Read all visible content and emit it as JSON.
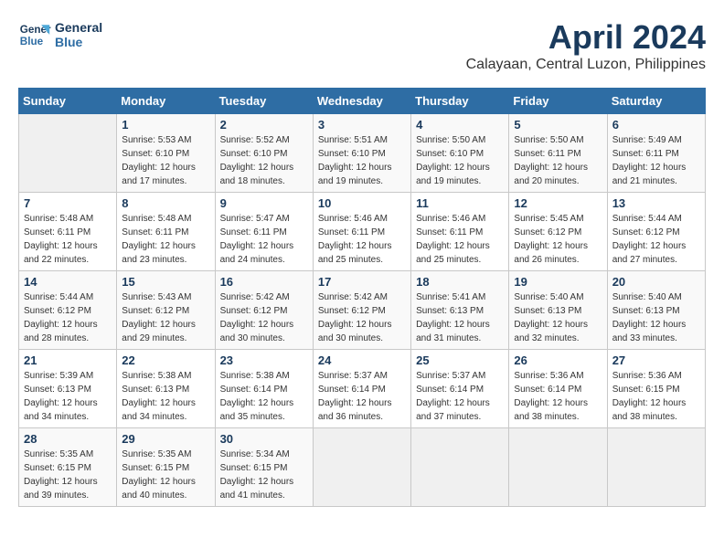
{
  "header": {
    "logo_line1": "General",
    "logo_line2": "Blue",
    "month": "April 2024",
    "location": "Calayaan, Central Luzon, Philippines"
  },
  "weekdays": [
    "Sunday",
    "Monday",
    "Tuesday",
    "Wednesday",
    "Thursday",
    "Friday",
    "Saturday"
  ],
  "weeks": [
    [
      {
        "day": "",
        "sunrise": "",
        "sunset": "",
        "daylight": ""
      },
      {
        "day": "1",
        "sunrise": "Sunrise: 5:53 AM",
        "sunset": "Sunset: 6:10 PM",
        "daylight": "Daylight: 12 hours and 17 minutes."
      },
      {
        "day": "2",
        "sunrise": "Sunrise: 5:52 AM",
        "sunset": "Sunset: 6:10 PM",
        "daylight": "Daylight: 12 hours and 18 minutes."
      },
      {
        "day": "3",
        "sunrise": "Sunrise: 5:51 AM",
        "sunset": "Sunset: 6:10 PM",
        "daylight": "Daylight: 12 hours and 19 minutes."
      },
      {
        "day": "4",
        "sunrise": "Sunrise: 5:50 AM",
        "sunset": "Sunset: 6:10 PM",
        "daylight": "Daylight: 12 hours and 19 minutes."
      },
      {
        "day": "5",
        "sunrise": "Sunrise: 5:50 AM",
        "sunset": "Sunset: 6:11 PM",
        "daylight": "Daylight: 12 hours and 20 minutes."
      },
      {
        "day": "6",
        "sunrise": "Sunrise: 5:49 AM",
        "sunset": "Sunset: 6:11 PM",
        "daylight": "Daylight: 12 hours and 21 minutes."
      }
    ],
    [
      {
        "day": "7",
        "sunrise": "Sunrise: 5:48 AM",
        "sunset": "Sunset: 6:11 PM",
        "daylight": "Daylight: 12 hours and 22 minutes."
      },
      {
        "day": "8",
        "sunrise": "Sunrise: 5:48 AM",
        "sunset": "Sunset: 6:11 PM",
        "daylight": "Daylight: 12 hours and 23 minutes."
      },
      {
        "day": "9",
        "sunrise": "Sunrise: 5:47 AM",
        "sunset": "Sunset: 6:11 PM",
        "daylight": "Daylight: 12 hours and 24 minutes."
      },
      {
        "day": "10",
        "sunrise": "Sunrise: 5:46 AM",
        "sunset": "Sunset: 6:11 PM",
        "daylight": "Daylight: 12 hours and 25 minutes."
      },
      {
        "day": "11",
        "sunrise": "Sunrise: 5:46 AM",
        "sunset": "Sunset: 6:11 PM",
        "daylight": "Daylight: 12 hours and 25 minutes."
      },
      {
        "day": "12",
        "sunrise": "Sunrise: 5:45 AM",
        "sunset": "Sunset: 6:12 PM",
        "daylight": "Daylight: 12 hours and 26 minutes."
      },
      {
        "day": "13",
        "sunrise": "Sunrise: 5:44 AM",
        "sunset": "Sunset: 6:12 PM",
        "daylight": "Daylight: 12 hours and 27 minutes."
      }
    ],
    [
      {
        "day": "14",
        "sunrise": "Sunrise: 5:44 AM",
        "sunset": "Sunset: 6:12 PM",
        "daylight": "Daylight: 12 hours and 28 minutes."
      },
      {
        "day": "15",
        "sunrise": "Sunrise: 5:43 AM",
        "sunset": "Sunset: 6:12 PM",
        "daylight": "Daylight: 12 hours and 29 minutes."
      },
      {
        "day": "16",
        "sunrise": "Sunrise: 5:42 AM",
        "sunset": "Sunset: 6:12 PM",
        "daylight": "Daylight: 12 hours and 30 minutes."
      },
      {
        "day": "17",
        "sunrise": "Sunrise: 5:42 AM",
        "sunset": "Sunset: 6:12 PM",
        "daylight": "Daylight: 12 hours and 30 minutes."
      },
      {
        "day": "18",
        "sunrise": "Sunrise: 5:41 AM",
        "sunset": "Sunset: 6:13 PM",
        "daylight": "Daylight: 12 hours and 31 minutes."
      },
      {
        "day": "19",
        "sunrise": "Sunrise: 5:40 AM",
        "sunset": "Sunset: 6:13 PM",
        "daylight": "Daylight: 12 hours and 32 minutes."
      },
      {
        "day": "20",
        "sunrise": "Sunrise: 5:40 AM",
        "sunset": "Sunset: 6:13 PM",
        "daylight": "Daylight: 12 hours and 33 minutes."
      }
    ],
    [
      {
        "day": "21",
        "sunrise": "Sunrise: 5:39 AM",
        "sunset": "Sunset: 6:13 PM",
        "daylight": "Daylight: 12 hours and 34 minutes."
      },
      {
        "day": "22",
        "sunrise": "Sunrise: 5:38 AM",
        "sunset": "Sunset: 6:13 PM",
        "daylight": "Daylight: 12 hours and 34 minutes."
      },
      {
        "day": "23",
        "sunrise": "Sunrise: 5:38 AM",
        "sunset": "Sunset: 6:14 PM",
        "daylight": "Daylight: 12 hours and 35 minutes."
      },
      {
        "day": "24",
        "sunrise": "Sunrise: 5:37 AM",
        "sunset": "Sunset: 6:14 PM",
        "daylight": "Daylight: 12 hours and 36 minutes."
      },
      {
        "day": "25",
        "sunrise": "Sunrise: 5:37 AM",
        "sunset": "Sunset: 6:14 PM",
        "daylight": "Daylight: 12 hours and 37 minutes."
      },
      {
        "day": "26",
        "sunrise": "Sunrise: 5:36 AM",
        "sunset": "Sunset: 6:14 PM",
        "daylight": "Daylight: 12 hours and 38 minutes."
      },
      {
        "day": "27",
        "sunrise": "Sunrise: 5:36 AM",
        "sunset": "Sunset: 6:15 PM",
        "daylight": "Daylight: 12 hours and 38 minutes."
      }
    ],
    [
      {
        "day": "28",
        "sunrise": "Sunrise: 5:35 AM",
        "sunset": "Sunset: 6:15 PM",
        "daylight": "Daylight: 12 hours and 39 minutes."
      },
      {
        "day": "29",
        "sunrise": "Sunrise: 5:35 AM",
        "sunset": "Sunset: 6:15 PM",
        "daylight": "Daylight: 12 hours and 40 minutes."
      },
      {
        "day": "30",
        "sunrise": "Sunrise: 5:34 AM",
        "sunset": "Sunset: 6:15 PM",
        "daylight": "Daylight: 12 hours and 41 minutes."
      },
      {
        "day": "",
        "sunrise": "",
        "sunset": "",
        "daylight": ""
      },
      {
        "day": "",
        "sunrise": "",
        "sunset": "",
        "daylight": ""
      },
      {
        "day": "",
        "sunrise": "",
        "sunset": "",
        "daylight": ""
      },
      {
        "day": "",
        "sunrise": "",
        "sunset": "",
        "daylight": ""
      }
    ]
  ]
}
